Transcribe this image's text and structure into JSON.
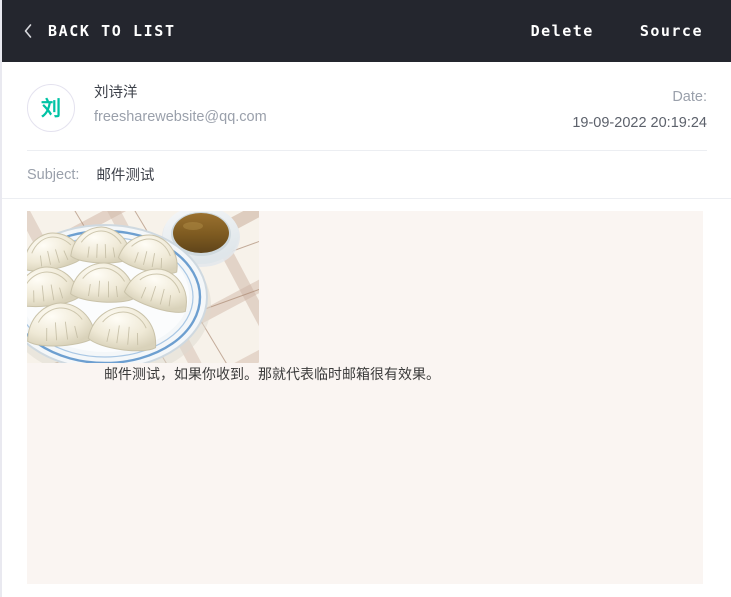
{
  "topbar": {
    "back_label": "BACK TO LIST",
    "back_icon": "chevron-left-icon",
    "delete_label": "Delete",
    "source_label": "Source",
    "background_color": "#24262e",
    "text_color": "#ffffff"
  },
  "sender": {
    "avatar_letter": "刘",
    "avatar_color": "#00c3a5",
    "avatar_border_color": "#e4e2ef",
    "name": "刘诗洋",
    "email": "freesharewebsite@qq.com"
  },
  "date": {
    "label": "Date:",
    "value": "19-09-2022 20:19:24"
  },
  "subject": {
    "label": "Subject:",
    "value": "邮件测试"
  },
  "body": {
    "background_color": "#faf5f2",
    "image_alt": "plate-of-dumplings-with-dipping-sauce-illustration",
    "text": "邮件测试，如果你收到。那就代表临时邮箱很有效果。"
  }
}
